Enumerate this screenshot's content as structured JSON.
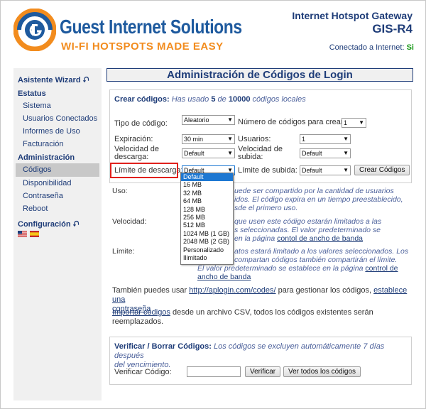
{
  "header": {
    "brand_name": "Guest Internet Solutions",
    "brand_tagline": "WI-FI HOTSPOTS MADE EASY",
    "product_line": "Internet Hotspot Gateway",
    "product_model": "GIS-R4",
    "connection_label": "Conectado a Internet:",
    "connection_value": "Si"
  },
  "sidebar": {
    "wizard": "Asistente Wizard",
    "estatus_head": "Estatus",
    "estatus_items": [
      "Sistema",
      "Usuarios Conectados",
      "Informes de Uso",
      "Facturación"
    ],
    "admin_head": "Administración",
    "admin_items": [
      "Códigos",
      "Disponibilidad",
      "Contraseña",
      "Reboot"
    ],
    "config_head": "Configuración"
  },
  "page_title": "Administración de Códigos de Login",
  "crear": {
    "title": "Crear códigos:",
    "info_pre": "Has usado",
    "used": "5",
    "info_mid": "de",
    "total": "10000",
    "info_post": "códigos locales",
    "tipo_label": "Tipo de código:",
    "tipo_value": "Aleatorio",
    "numero_label": "Número de códigos para crear:",
    "numero_value": "1",
    "expiracion_label": "Expiración:",
    "expiracion_value": "30 min",
    "usuarios_label": "Usuarios:",
    "usuarios_value": "1",
    "vel_descarga_label": "Velocidad de descarga:",
    "vel_descarga_value": "Default",
    "vel_subida_label": "Velocidad de subida:",
    "vel_subida_value": "Default",
    "lim_descarga_label": "Límite de descarga:",
    "lim_descarga_value": "Default",
    "lim_subida_label": "Límite de subida:",
    "lim_subida_value": "Default",
    "create_button": "Crear Códigos"
  },
  "dropdown_options": [
    "Default",
    "16 MB",
    "32 MB",
    "64 MB",
    "128 MB",
    "256 MB",
    "512 MB",
    "1024 MB (1 GB)",
    "2048 MB (2 GB)",
    "Personalizado",
    "Ilimitado"
  ],
  "help": {
    "uso_label": "Uso:",
    "uso_text_1": "uede ser compartido por la cantidad de usuarios",
    "uso_text_2": "idos. El código expira en un tiempo preestablecido,",
    "uso_text_3": "sde el primero uso.",
    "vel_label": "Velocidad:",
    "vel_text_1": "que usen este código estarán limitados a las",
    "vel_text_2": "s seleccionadas. El valor predeterminado se",
    "vel_text_3": "en la página",
    "vel_link": "contol de ancho de banda",
    "lim_label": "Límite:",
    "lim_text_1": "atos estará limitado a los valores seleccionados. Los",
    "lim_text_2": "compartan códigos también compartirán el límite.",
    "lim_text_3": "El valor predeterminado se establece en la página",
    "lim_link_1": "control de",
    "lim_link_2": "ancho de banda"
  },
  "extra": {
    "also_pre": "También puedes usar",
    "also_link": "http://aplogin.com/codes/",
    "also_mid": "para gestionar los códigos,",
    "also_link2": "establece una",
    "also_link3": "contraseña",
    "import_link": "Importar códigos",
    "import_text": "desde un archivo CSV, todos los códigos existentes serán",
    "import_text2": "reemplazados."
  },
  "verificar": {
    "title": "Verificar / Borrar Códigos:",
    "info_1": "Los códigos se excluyen automáticamente 7 días después",
    "info_2": "del vencimiento.",
    "code_label": "Verificar Código:",
    "verify_button": "Verificar",
    "all_button": "Ver todos los códigos"
  },
  "colors": {
    "brand_blue": "#1e5a9e",
    "brand_orange": "#f28c1e",
    "nav_blue": "#1e3c78",
    "highlight_red": "#e0201c"
  }
}
